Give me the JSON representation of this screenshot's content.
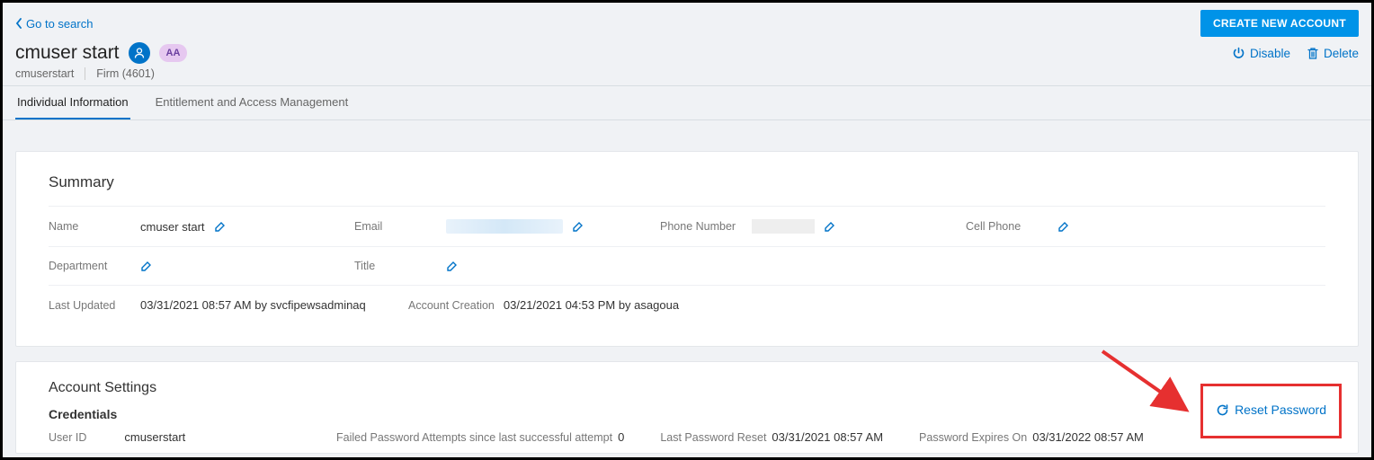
{
  "nav": {
    "go_to_search": "Go to search",
    "create_account_btn": "CREATE NEW ACCOUNT"
  },
  "header": {
    "title": "cmuser start",
    "badge": "AA",
    "disable": "Disable",
    "delete": "Delete"
  },
  "subline": {
    "username": "cmuserstart",
    "firm": "Firm (4601)"
  },
  "tabs": {
    "individual": "Individual Information",
    "entitlement": "Entitlement and Access Management"
  },
  "summary": {
    "heading": "Summary",
    "labels": {
      "name": "Name",
      "email": "Email",
      "phone": "Phone Number",
      "cell": "Cell Phone",
      "department": "Department",
      "title": "Title",
      "last_updated": "Last Updated",
      "account_creation": "Account Creation"
    },
    "values": {
      "name": "cmuser start",
      "last_updated": "03/31/2021 08:57 AM by svcfipewsadminaq",
      "account_creation": "03/21/2021 04:53 PM by asagoua"
    }
  },
  "account": {
    "heading": "Account Settings",
    "sub": "Credentials",
    "labels": {
      "user_id": "User ID",
      "failed": "Failed Password Attempts since last successful attempt",
      "last_reset": "Last Password Reset",
      "expires": "Password Expires On"
    },
    "values": {
      "user_id": "cmuserstart",
      "failed": "0",
      "last_reset": "03/31/2021 08:57 AM",
      "expires": "03/31/2022 08:57 AM"
    },
    "reset": "Reset Password"
  }
}
